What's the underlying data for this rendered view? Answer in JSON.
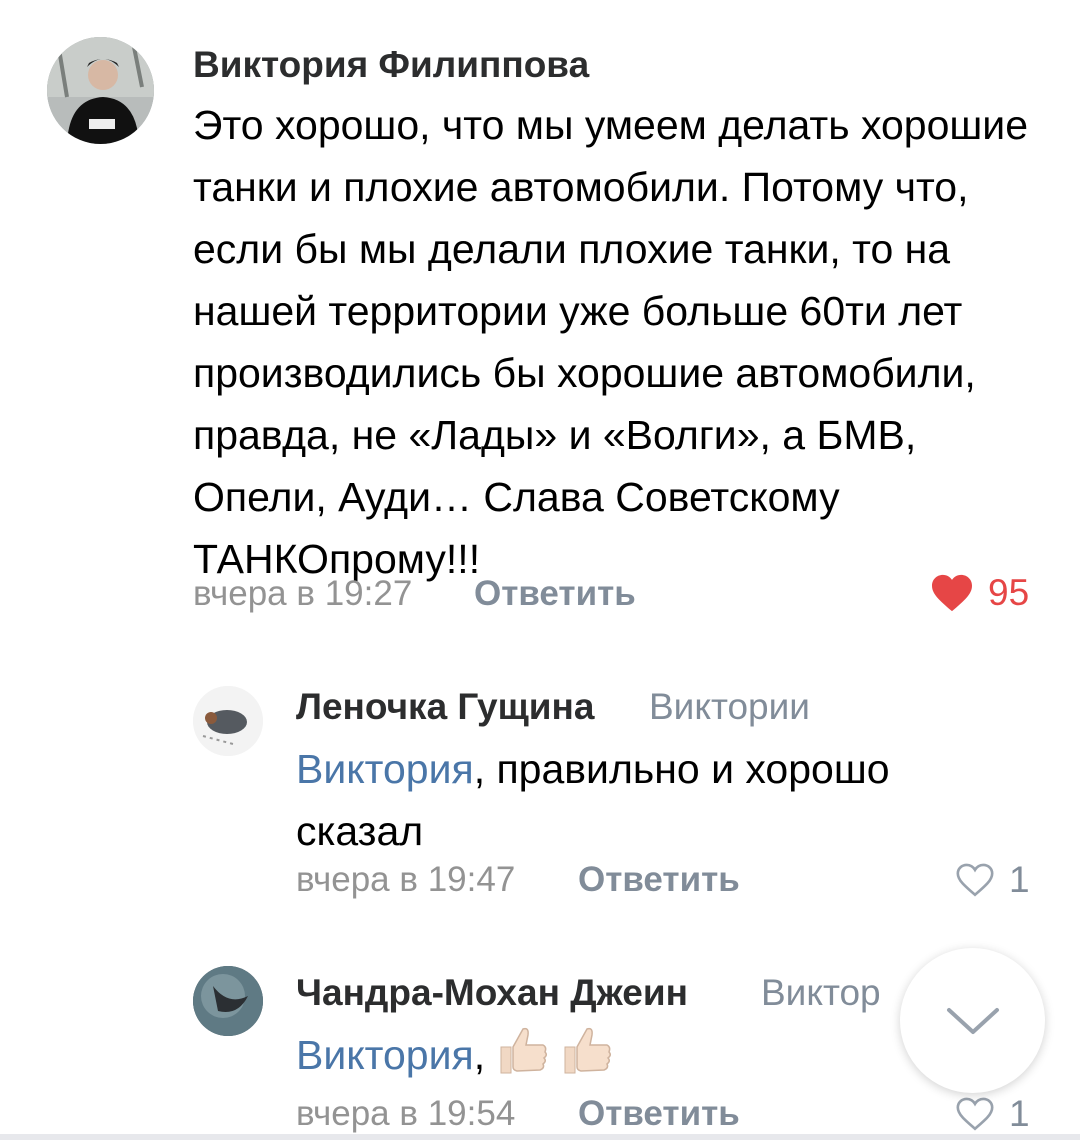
{
  "comments": [
    {
      "author": "Виктория Филиппова",
      "avatar_icon": "user-photo",
      "text": "Это хорошо, что мы умеем делать хорошие танки и плохие автомобили. Потому что, если бы мы делали плохие танки, то на нашей территории уже больше 60ти лет производились бы хорошие автомобили, правда, не «Лады» и «Волги», а БМВ, Опели, Ауди… Слава Советскому ТАНКОпрому!!!",
      "time": "вчера в 19:27",
      "reply_label": "Ответить",
      "likes": "95",
      "liked": true
    },
    {
      "author": "Леночка Гущина",
      "reply_to": "Виктории",
      "mention": "Виктория",
      "text": ", правильно и хорошо сказал",
      "time": "вчера в 19:47",
      "reply_label": "Ответить",
      "likes": "1",
      "liked": false
    },
    {
      "author": "Чандра-Мохан Джеин",
      "reply_to": "Виктор",
      "mention": "Виктория",
      "text": ",",
      "emoji": [
        "thumbs-up",
        "thumbs-up"
      ],
      "time": "вчера в 19:54",
      "reply_label": "Ответить",
      "likes": "1",
      "liked": false
    }
  ],
  "colors": {
    "author": "#2c2d2e",
    "meta": "#939393",
    "mention": "#4a76a8",
    "like_active": "#e64646"
  }
}
